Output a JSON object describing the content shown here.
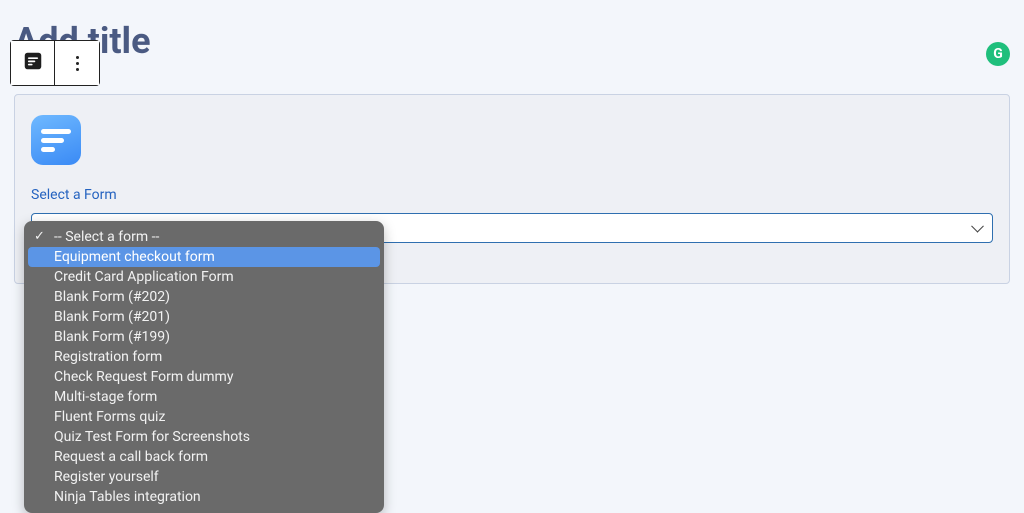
{
  "page": {
    "title": "Add title"
  },
  "badge": {
    "letter": "G"
  },
  "block": {
    "label": "Select a Form"
  },
  "dropdown": {
    "items": [
      {
        "label": "-- Select a form --",
        "selected": true,
        "highlighted": false
      },
      {
        "label": "Equipment checkout form",
        "selected": false,
        "highlighted": true
      },
      {
        "label": "Credit Card Application Form",
        "selected": false,
        "highlighted": false
      },
      {
        "label": "Blank Form (#202)",
        "selected": false,
        "highlighted": false
      },
      {
        "label": "Blank Form (#201)",
        "selected": false,
        "highlighted": false
      },
      {
        "label": "Blank Form (#199)",
        "selected": false,
        "highlighted": false
      },
      {
        "label": "Registration form",
        "selected": false,
        "highlighted": false
      },
      {
        "label": "Check Request Form dummy",
        "selected": false,
        "highlighted": false
      },
      {
        "label": "Multi-stage form",
        "selected": false,
        "highlighted": false
      },
      {
        "label": "Fluent Forms quiz",
        "selected": false,
        "highlighted": false
      },
      {
        "label": "Quiz Test Form for Screenshots",
        "selected": false,
        "highlighted": false
      },
      {
        "label": "Request a call back form",
        "selected": false,
        "highlighted": false
      },
      {
        "label": "Register yourself",
        "selected": false,
        "highlighted": false
      },
      {
        "label": "Ninja Tables integration",
        "selected": false,
        "highlighted": false
      }
    ]
  }
}
